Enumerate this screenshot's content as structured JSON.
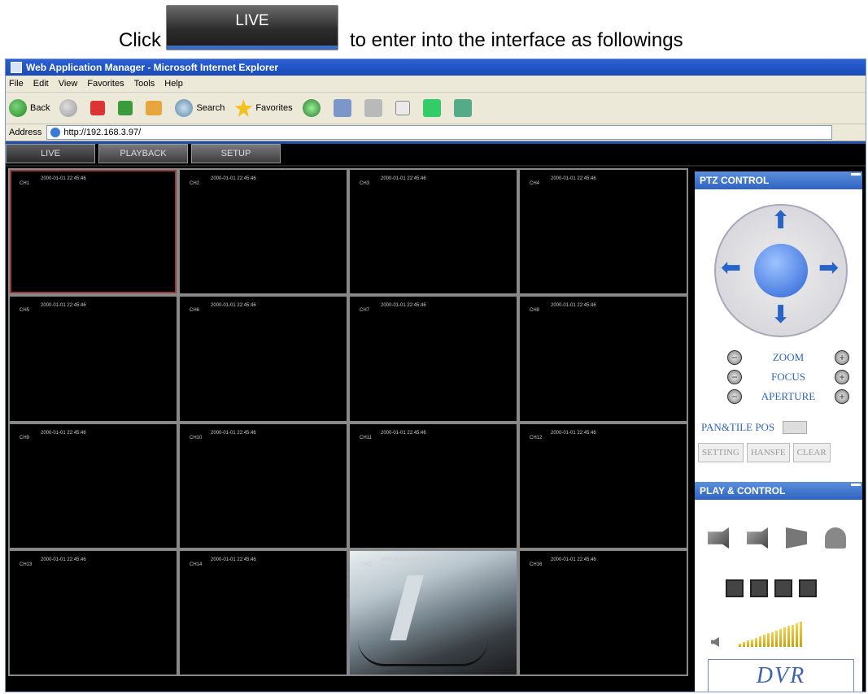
{
  "intro": {
    "click": "Click",
    "button_label": "LIVE",
    "rest": "to enter into the interface as followings"
  },
  "browser": {
    "title": "Web Application Manager - Microsoft Internet Explorer",
    "menu": [
      "File",
      "Edit",
      "View",
      "Favorites",
      "Tools",
      "Help"
    ],
    "toolbar": {
      "back": "Back",
      "search": "Search",
      "favorites": "Favorites"
    },
    "address_label": "Address",
    "address_value": "http://192.168.3.97/"
  },
  "app": {
    "tabs": [
      "LIVE",
      "PLAYBACK",
      "SETUP"
    ],
    "active_tab": "LIVE",
    "grid": {
      "timestamp": "2000-01-01 22:45:46",
      "channels": [
        "CH1",
        "CH2",
        "CH3",
        "CH4",
        "CH5",
        "CH6",
        "CH7",
        "CH8",
        "CH9",
        "CH10",
        "CH11",
        "CH12",
        "CH13",
        "CH14",
        "CH15",
        "CH16"
      ],
      "selected": 0,
      "video_channel": 14
    },
    "ptz": {
      "title": "PTZ CONTROL",
      "zoom": "ZOOM",
      "focus": "FOCUS",
      "aperture": "APERTURE",
      "pan_tile_pos": "PAN&TILE POS",
      "buttons": [
        "SETTING",
        "HANSFE",
        "CLEAR"
      ],
      "minus": "−",
      "plus": "+"
    },
    "play": {
      "title": "PLAY & CONTROL",
      "logo": "DVR",
      "volume_level": 1.0
    }
  },
  "colors": {
    "accent": "#2f63c1",
    "selected_border": "#9a3a3a"
  }
}
